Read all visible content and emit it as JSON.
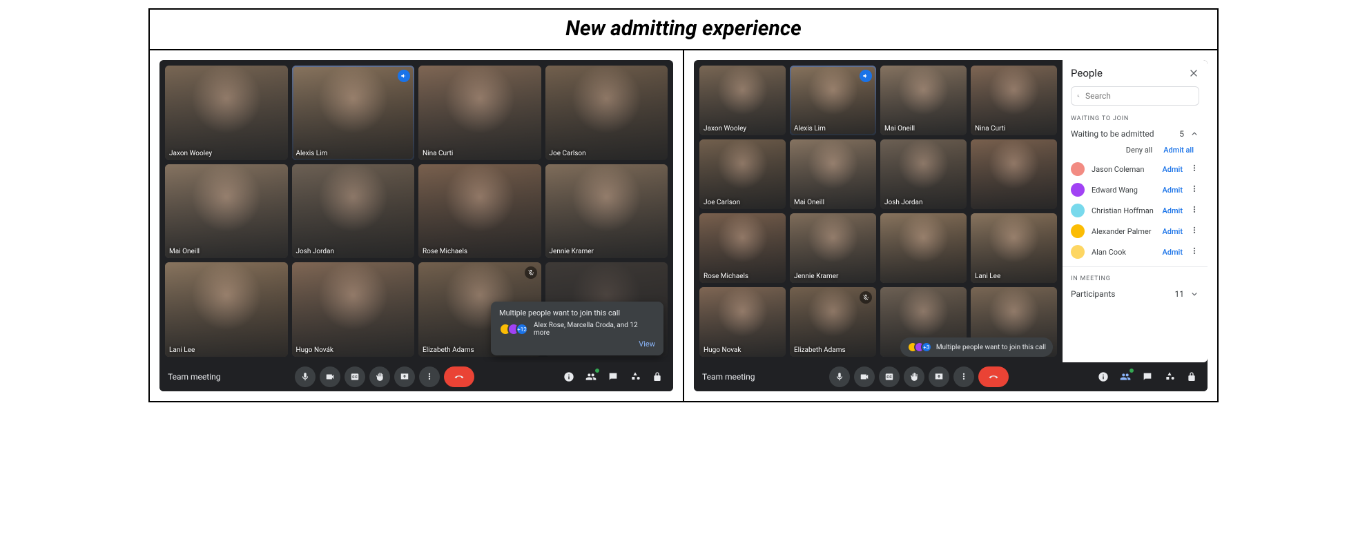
{
  "title": "New admitting experience",
  "meeting_name": "Team meeting",
  "left": {
    "tiles": [
      {
        "name": "Jaxon Wooley",
        "bg": "bg1"
      },
      {
        "name": "Alexis Lim",
        "bg": "bg2",
        "speaking": true
      },
      {
        "name": "Nina Curti",
        "bg": "bg3"
      },
      {
        "name": "Joe Carlson",
        "bg": "bg4"
      },
      {
        "name": "Mai Oneill",
        "bg": "bg5"
      },
      {
        "name": "Josh Jordan",
        "bg": "bg6"
      },
      {
        "name": "Rose Michaels",
        "bg": "bg7"
      },
      {
        "name": "Jennie Kramer",
        "bg": "bg8"
      },
      {
        "name": "Lani Lee",
        "bg": "bg2"
      },
      {
        "name": "Hugo Novák",
        "bg": "bg3"
      },
      {
        "name": "Elizabeth Adams",
        "bg": "bg4",
        "muted": true
      },
      {
        "name": "",
        "bg": "bg6",
        "covered": true
      }
    ],
    "toast": {
      "title": "Multiple people want to join this call",
      "subtitle": "Alex Rose, Marcella Croda, and 12 more",
      "more": "+12",
      "view": "View"
    }
  },
  "right": {
    "tiles": [
      {
        "name": "Jaxon Wooley",
        "bg": "bg1"
      },
      {
        "name": "Alexis Lim",
        "bg": "bg2",
        "speaking": true
      },
      {
        "name": "Mai Oneill",
        "bg": "bg5"
      },
      {
        "name": "Nina Curti",
        "bg": "bg3"
      },
      {
        "name": "Joe Carlson",
        "bg": "bg4"
      },
      {
        "name": "Mai Oneill",
        "bg": "bg5"
      },
      {
        "name": "Josh Jordan",
        "bg": "bg6"
      },
      {
        "name": "",
        "bg": "bg7"
      },
      {
        "name": "Rose Michaels",
        "bg": "bg7"
      },
      {
        "name": "Jennie Kramer",
        "bg": "bg8"
      },
      {
        "name": "",
        "bg": "bg2"
      },
      {
        "name": "Lani Lee",
        "bg": "bg2"
      },
      {
        "name": "Hugo Novak",
        "bg": "bg3"
      },
      {
        "name": "Elizabeth Adams",
        "bg": "bg4",
        "muted": true
      },
      {
        "name": "",
        "bg": "bg6"
      },
      {
        "name": "",
        "bg": "bg1"
      }
    ],
    "toast": {
      "text": "Multiple people want to join this call",
      "more": "+3"
    },
    "people": {
      "title": "People",
      "search_placeholder": "Search",
      "waiting_label": "WAITING TO JOIN",
      "waiting_header": "Waiting to be admitted",
      "waiting_count": "5",
      "deny_all": "Deny all",
      "admit_all": "Admit all",
      "admit": "Admit",
      "waiting": [
        {
          "name": "Jason Coleman",
          "color": "#f28b82"
        },
        {
          "name": "Edward Wang",
          "color": "#a142f4"
        },
        {
          "name": "Christian Hoffman",
          "color": "#78d9ec"
        },
        {
          "name": "Alexander Palmer",
          "color": "#fbbc04"
        },
        {
          "name": "Alan Cook",
          "color": "#fdd663"
        }
      ],
      "in_meeting_label": "IN MEETING",
      "participants_header": "Participants",
      "participants_count": "11"
    }
  },
  "controls": {
    "mic": "microphone",
    "cam": "camera",
    "cc": "captions",
    "hand": "raise-hand",
    "present": "present",
    "more": "more",
    "leave": "leave"
  }
}
